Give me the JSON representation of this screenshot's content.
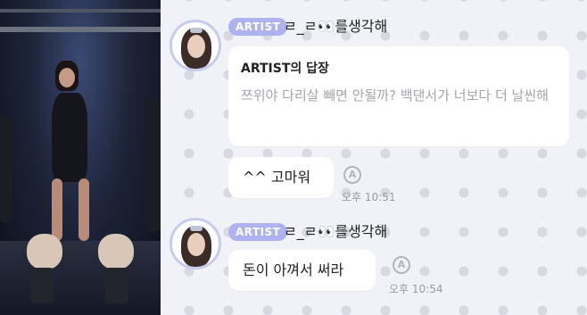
{
  "messages": [
    {
      "badge": "ARTIST",
      "sender": "ㄹ_ㄹ👀를생각해",
      "reply_header": "ARTIST의 답장",
      "reply_text": "쯔위야 다리살 빼면 안될까? 백댄서가 너보다 더 날씬해",
      "read_icon": "A",
      "text": "^^ 고마워",
      "time": "오후 10:51"
    },
    {
      "badge": "ARTIST",
      "sender": "ㄹ_ㄹ👀를생각해",
      "read_icon": "A",
      "text": "돈이 아껴서 써라",
      "time": "오후 10:54"
    }
  ],
  "colors": {
    "badge": "#aeb3f0",
    "chat_background": "#f1f2f8",
    "bubble": "#ffffff",
    "quote_text": "#a3a5ad",
    "time_text": "#9a9aa2"
  }
}
